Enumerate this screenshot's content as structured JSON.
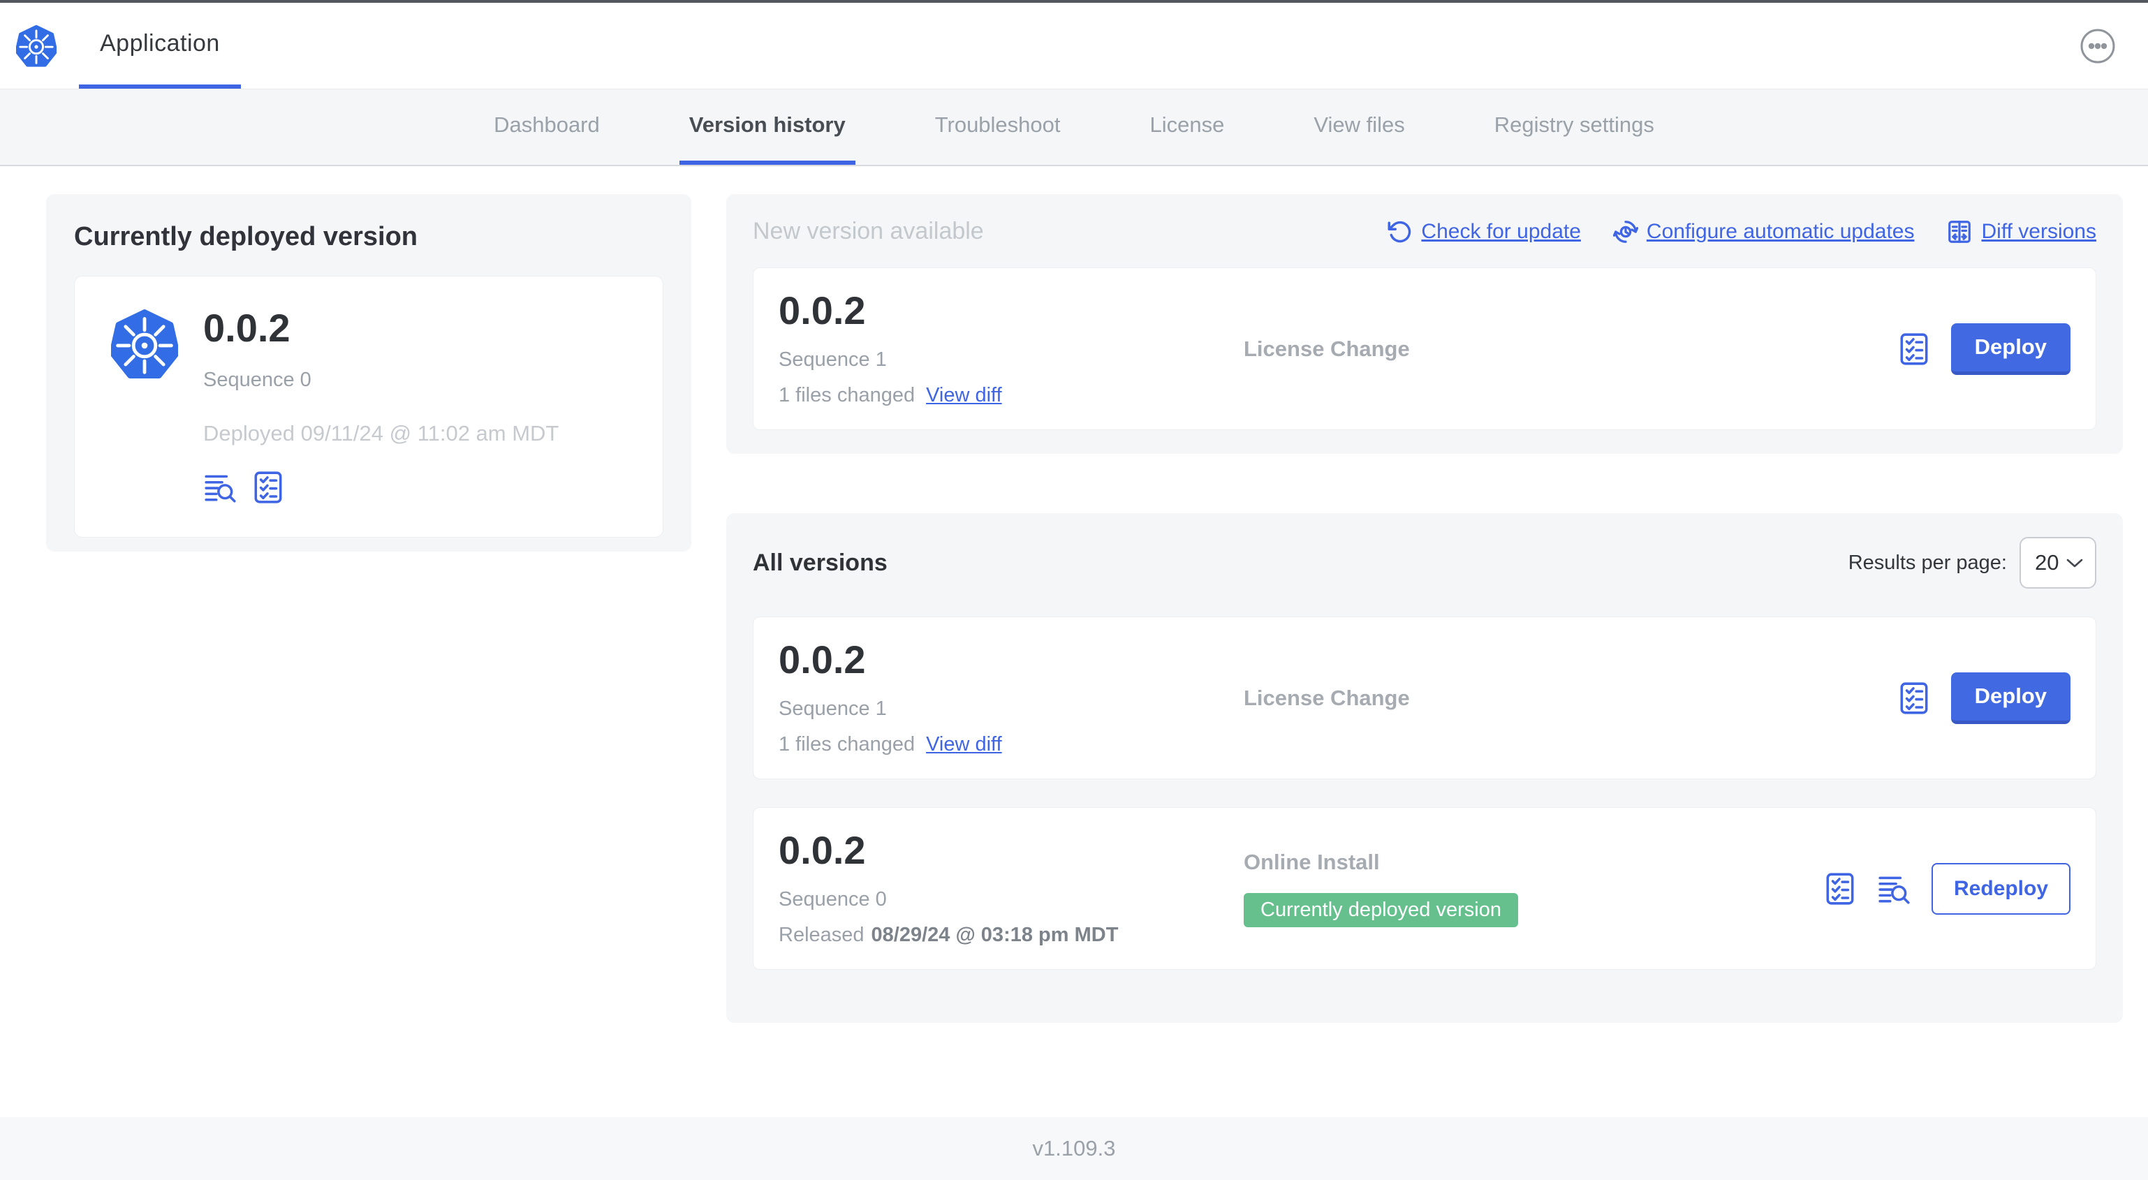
{
  "header": {
    "app_title": "Application"
  },
  "tabs": {
    "items": [
      "Dashboard",
      "Version history",
      "Troubleshoot",
      "License",
      "View files",
      "Registry settings"
    ],
    "active": "Version history"
  },
  "currently_deployed": {
    "title": "Currently deployed version",
    "version": "0.0.2",
    "sequence": "Sequence 0",
    "deployed": "Deployed 09/11/24 @ 11:02 am MDT"
  },
  "new_version": {
    "title": "New version available",
    "actions": {
      "check_for_update": "Check for update",
      "configure_automatic_updates": "Configure automatic updates",
      "diff_versions": "Diff versions"
    },
    "row": {
      "version": "0.0.2",
      "sequence": "Sequence 1",
      "files_changed": "1 files changed",
      "view_diff_label": "View diff",
      "source": "License Change",
      "action_label": "Deploy"
    }
  },
  "all_versions": {
    "title": "All versions",
    "results_per_page_label": "Results per page:",
    "per_page_value": "20",
    "rows": [
      {
        "version": "0.0.2",
        "sequence": "Sequence 1",
        "files_changed": "1 files changed",
        "view_diff_label": "View diff",
        "source": "License Change",
        "action_label": "Deploy"
      },
      {
        "version": "0.0.2",
        "sequence": "Sequence 0",
        "released_prefix": "Released",
        "released_date": "08/29/24 @ 03:18 pm MDT",
        "source": "Online Install",
        "badge": "Currently deployed version",
        "action_label": "Redeploy"
      }
    ]
  },
  "footer": {
    "version": "v1.109.3"
  },
  "icons": {
    "app_logo": "kubernetes-logo",
    "header_menu": "ellipsis-menu-icon",
    "check_for_update": "refresh-icon",
    "configure_automatic_updates": "auto-update-clock-icon",
    "diff_versions": "diff-columns-icon",
    "release_notes": "release-notes-search-icon",
    "preflight_checks": "preflight-checklist-icon",
    "per_page": "chevron-down-icon"
  },
  "colors": {
    "primary_blue": "#3f65e4",
    "kubernetes_blue": "#326de6",
    "button_blue": "#4169e1",
    "badge_green": "#65c08e",
    "dark_text": "#2f3237",
    "muted_text": "#9aa0a8",
    "faint_text": "#c6cacf",
    "section_bg": "#f5f6f8"
  }
}
